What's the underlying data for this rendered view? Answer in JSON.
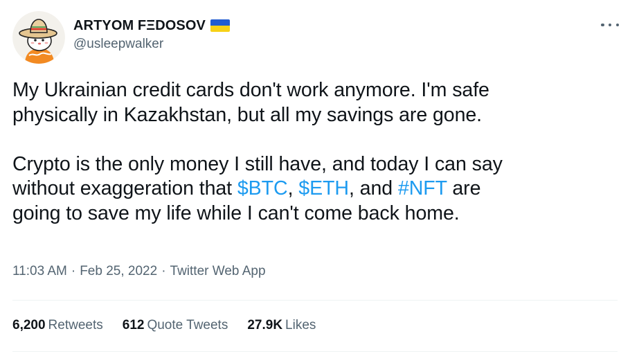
{
  "author": {
    "display_name": "ARTYOM FΞDOSOV",
    "handle": "@usleepwalker",
    "avatar_icon": "cartoon-avatar-sombrero",
    "flag_colors": [
      "#1f5bd1",
      "#f7d117"
    ]
  },
  "tweet": {
    "paragraph1_line1": "My Ukrainian credit cards don't work anymore. I'm safe",
    "paragraph1_line2": "physically in Kazakhstan, but all my savings are gone.",
    "paragraph2_line1": "Crypto is the only money I still have, and today I can say",
    "paragraph2_line2_prefix": "without exaggeration that ",
    "tag_btc": "$BTC",
    "comma_1": ", ",
    "tag_eth": "$ETH",
    "and_text": ", and ",
    "tag_nft": "#NFT",
    "line2_suffix": " are",
    "paragraph2_line3": "going to save my life while I can't come back home."
  },
  "meta": {
    "time": "11:03 AM",
    "separator": "·",
    "date": "Feb 25, 2022",
    "source": "Twitter Web App"
  },
  "stats": {
    "retweets_count": "6,200",
    "retweets_label": "Retweets",
    "quote_count": "612",
    "quote_label": "Quote Tweets",
    "likes_count": "27.9K",
    "likes_label": "Likes"
  },
  "colors": {
    "link": "#1d9bf0",
    "text": "#0f1419",
    "secondary": "#536471"
  }
}
